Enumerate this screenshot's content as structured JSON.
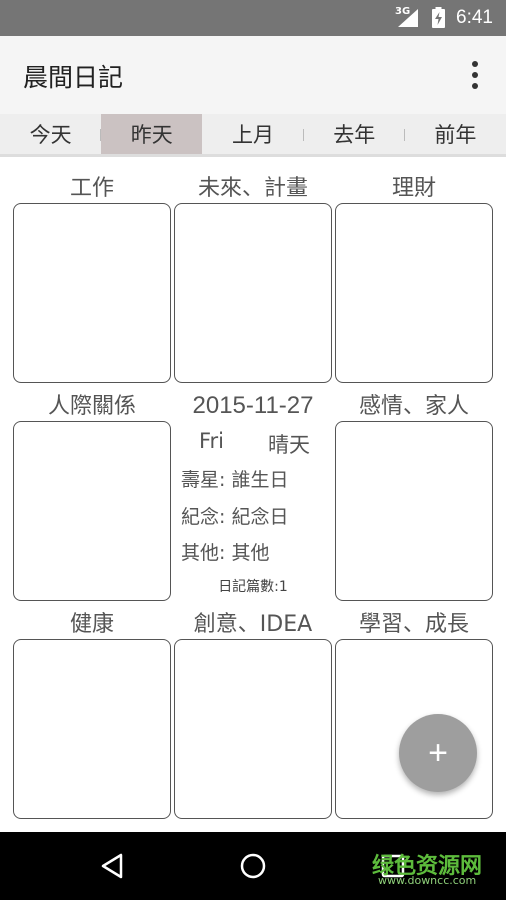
{
  "status_bar": {
    "network": "3G",
    "time": "6:41"
  },
  "app_bar": {
    "title": "晨間日記"
  },
  "tabs": [
    {
      "label": "今天",
      "active": false
    },
    {
      "label": "昨天",
      "active": true
    },
    {
      "label": "上月",
      "active": false
    },
    {
      "label": "去年",
      "active": false
    },
    {
      "label": "前年",
      "active": false
    }
  ],
  "categories": {
    "work": "工作",
    "future_plan": "未來、計畫",
    "finance": "理財",
    "relationships": "人際關係",
    "family": "感情、家人",
    "health": "健康",
    "creativity": "創意、IDEA",
    "learning": "學習、成長"
  },
  "day_info": {
    "date": "2015-11-27",
    "weekday": "Fri",
    "weather": "晴天",
    "birthday_row": "壽星: 誰生日",
    "anniversary_row": "紀念: 紀念日",
    "other_row": "其他: 其他",
    "diary_count": "日記篇數:1"
  },
  "fab": {
    "symbol": "+"
  },
  "watermark": {
    "text": "绿色资源网",
    "url": "www.downcc.com"
  },
  "colors": {
    "status_bar": "#757575",
    "app_bar": "#f5f5f5",
    "tab_active": "#cbc2c2",
    "fab": "#9e9e9e",
    "nav_bar": "#000000"
  }
}
